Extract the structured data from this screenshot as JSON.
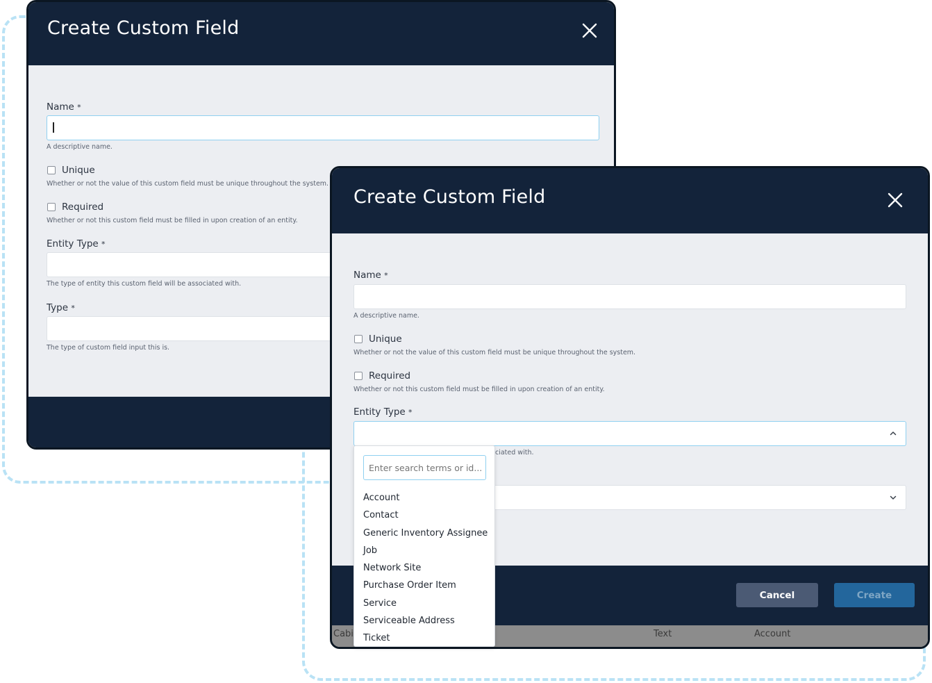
{
  "dialog_title": "Create Custom Field",
  "form": {
    "name_label": "Name",
    "name_help": "A descriptive name.",
    "unique_label": "Unique",
    "unique_help": "Whether or not the value of this custom field must be unique throughout the system.",
    "required_label": "Required",
    "required_help": "Whether or not this custom field must be filled in upon creation of an entity.",
    "entity_type_label": "Entity Type",
    "entity_type_help": "The type of entity this custom field will be associated with.",
    "entity_type_help_visible": "ciated with.",
    "type_label": "Type",
    "type_help": "The type of custom field input this is.",
    "required_marker": "*"
  },
  "footer": {
    "cancel_label": "Cancel",
    "create_label": "Create"
  },
  "entity_dropdown": {
    "search_placeholder": "Enter search terms or id...",
    "options": [
      "Account",
      "Contact",
      "Generic Inventory Assignee",
      "Job",
      "Network Site",
      "Purchase Order Item",
      "Service",
      "Serviceable Address",
      "Ticket"
    ]
  },
  "background_table": {
    "cells": [
      "Cabin",
      "Text",
      "Account"
    ]
  },
  "colors": {
    "header_bg": "#13233a",
    "body_bg": "#eceef2",
    "focus_border": "#8fd0f0",
    "cancel_bg": "#4b5a74",
    "create_bg": "#23669c",
    "dash": "#b9e2f5"
  },
  "icons": {
    "close": "close-icon",
    "chevron_up": "chevron-up-icon",
    "chevron_down": "chevron-down-icon"
  }
}
